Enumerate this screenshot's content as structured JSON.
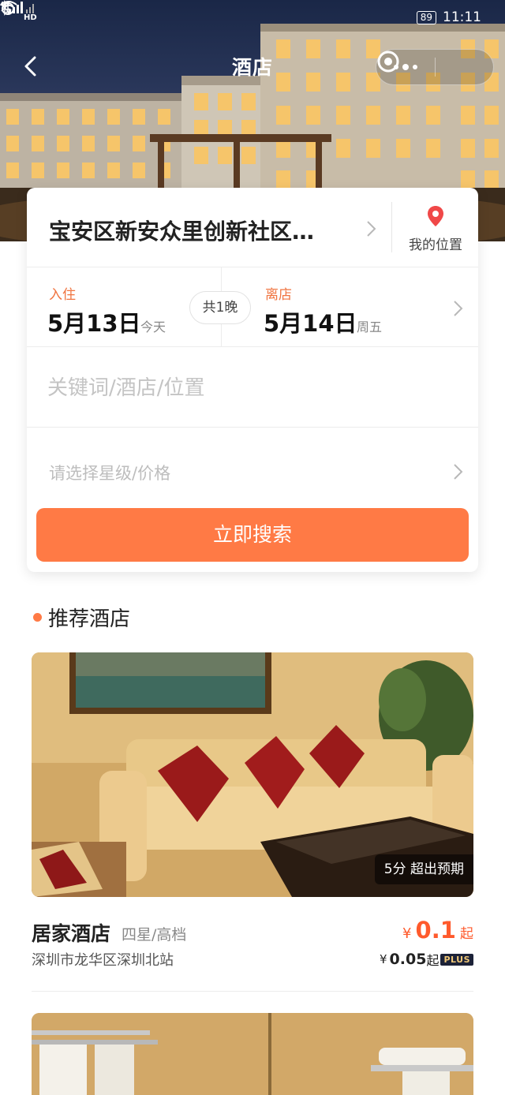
{
  "status_bar": {
    "hd_label": "HD",
    "net_label": "4G",
    "battery": "89",
    "time": "11:11"
  },
  "nav": {
    "title": "酒店"
  },
  "search": {
    "location": "宝安区新安众里创新社区…",
    "my_location": "我的位置",
    "checkin_label": "入住",
    "checkin_date": "5月13日",
    "checkin_day": "今天",
    "nights": "共1晚",
    "checkout_label": "离店",
    "checkout_date": "5月14日",
    "checkout_day": "周五",
    "keyword_placeholder": "关键词/酒店/位置",
    "star_price_placeholder": "请选择星级/价格",
    "submit_label": "立即搜索"
  },
  "recommend": {
    "section_title": "推荐酒店",
    "hotels": [
      {
        "name": "居家酒店",
        "level": "四星/高档",
        "address": "深圳市龙华区深圳北站",
        "score_tag": "5分 超出预期",
        "price_currency": "¥",
        "price": "0.1",
        "price_suffix": "起",
        "plus_currency": "¥",
        "plus_price": "0.05",
        "plus_suffix": "起",
        "plus_badge": "PLUS"
      }
    ]
  },
  "colors": {
    "accent": "#ff7a45",
    "price": "#ff5a2c",
    "pin": "#f04848"
  }
}
